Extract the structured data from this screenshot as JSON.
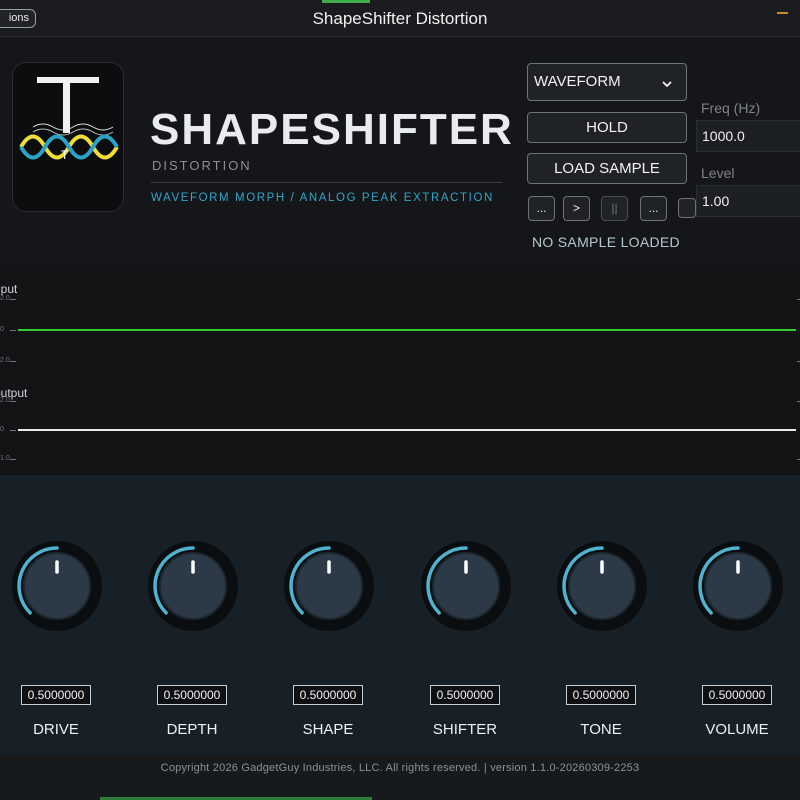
{
  "window": {
    "title": "ShapeShifter Distortion",
    "options_label": "ions"
  },
  "brand": {
    "title": "SHAPESHIFTER",
    "subtitle": "DISTORTION",
    "tagline": "WAVEFORM MORPH / ANALOG PEAK EXTRACTION",
    "logo_letter": "T"
  },
  "controls": {
    "source_select": "WAVEFORM",
    "hold_label": "HOLD",
    "load_label": "LOAD SAMPLE",
    "transport": [
      "...",
      ">",
      "||",
      "..."
    ],
    "sample_status": "NO SAMPLE LOADED",
    "freq_label": "Freq (Hz)",
    "freq_value": "1000.0",
    "level_label": "Level",
    "level_value": "1.00"
  },
  "scopes": {
    "input": {
      "label": "nput",
      "ticks": [
        "2.0",
        "0",
        "2.0"
      ],
      "color": "#33cc33"
    },
    "output": {
      "label": "output",
      "ticks": [
        "2.0",
        "0",
        "1.0"
      ],
      "color": "#e8e8e8"
    }
  },
  "knobs": [
    {
      "name": "DRIVE",
      "value": "0.5000000",
      "level": 0.5
    },
    {
      "name": "DEPTH",
      "value": "0.5000000",
      "level": 0.5
    },
    {
      "name": "SHAPE",
      "value": "0.5000000",
      "level": 0.5
    },
    {
      "name": "SHIFTER",
      "value": "0.5000000",
      "level": 0.5
    },
    {
      "name": "TONE",
      "value": "0.5000000",
      "level": 0.5
    },
    {
      "name": "VOLUME",
      "value": "0.5000000",
      "level": 0.5
    }
  ],
  "colors": {
    "accent": "#2fa6c9",
    "knob_arc": "#4fb3cf",
    "input_trace": "#33cc33"
  },
  "footer": {
    "copyright": "Copyright 2026 GadgetGuy Industries, LLC. All rights reserved. | version 1.1.0-20260309-2253"
  }
}
